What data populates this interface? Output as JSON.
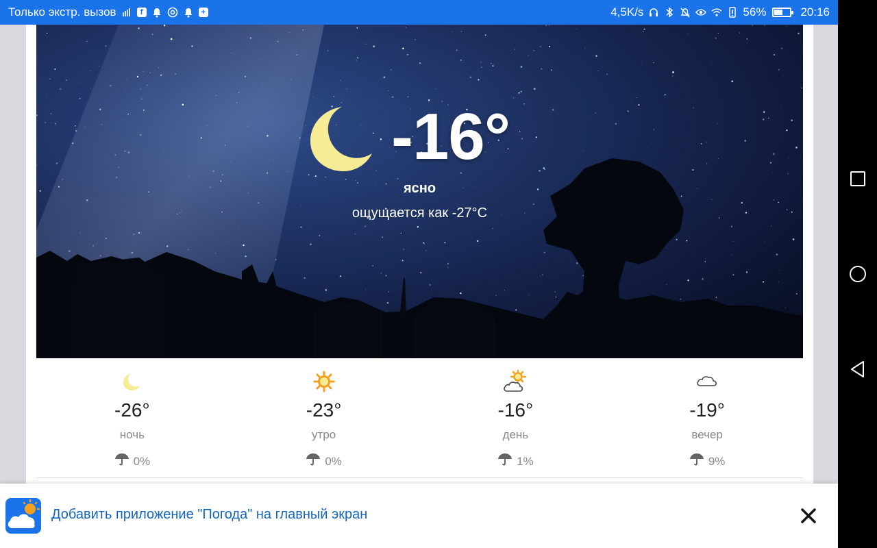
{
  "status_bar": {
    "carrier": "Только экстр. вызов",
    "speed": "4,5K/s",
    "battery": "56%",
    "battery_level": 0.56,
    "time": "20:16",
    "icons_left": [
      "signal-icon",
      "facebook-icon",
      "bell-icon",
      "at-icon",
      "bell-icon",
      "plus-square-icon"
    ],
    "icons_right": [
      "headphones-icon",
      "bluetooth-icon",
      "mute-icon",
      "eye-icon",
      "wifi-icon",
      "alert-icon"
    ]
  },
  "current": {
    "icon": "moon-icon",
    "temperature": "-16°",
    "condition": "ясно",
    "feels_like": "ощущается как -27°C"
  },
  "periods": [
    {
      "icon": "moon-icon",
      "temperature": "-26°",
      "name": "ночь",
      "precip": "0%"
    },
    {
      "icon": "sun-icon",
      "temperature": "-23°",
      "name": "утро",
      "precip": "0%"
    },
    {
      "icon": "sun-cloud-icon",
      "temperature": "-16°",
      "name": "день",
      "precip": "1%"
    },
    {
      "icon": "cloud-icon",
      "temperature": "-19°",
      "name": "вечер",
      "precip": "9%"
    }
  ],
  "banner": {
    "text": "Добавить приложение \"Погода\" на главный экран",
    "close_icon": "close-icon"
  },
  "colors": {
    "status_bar": "#1a73e8",
    "banner_text": "#1565c0",
    "moon": "#f6ec95",
    "sun": "#f2a01f"
  }
}
